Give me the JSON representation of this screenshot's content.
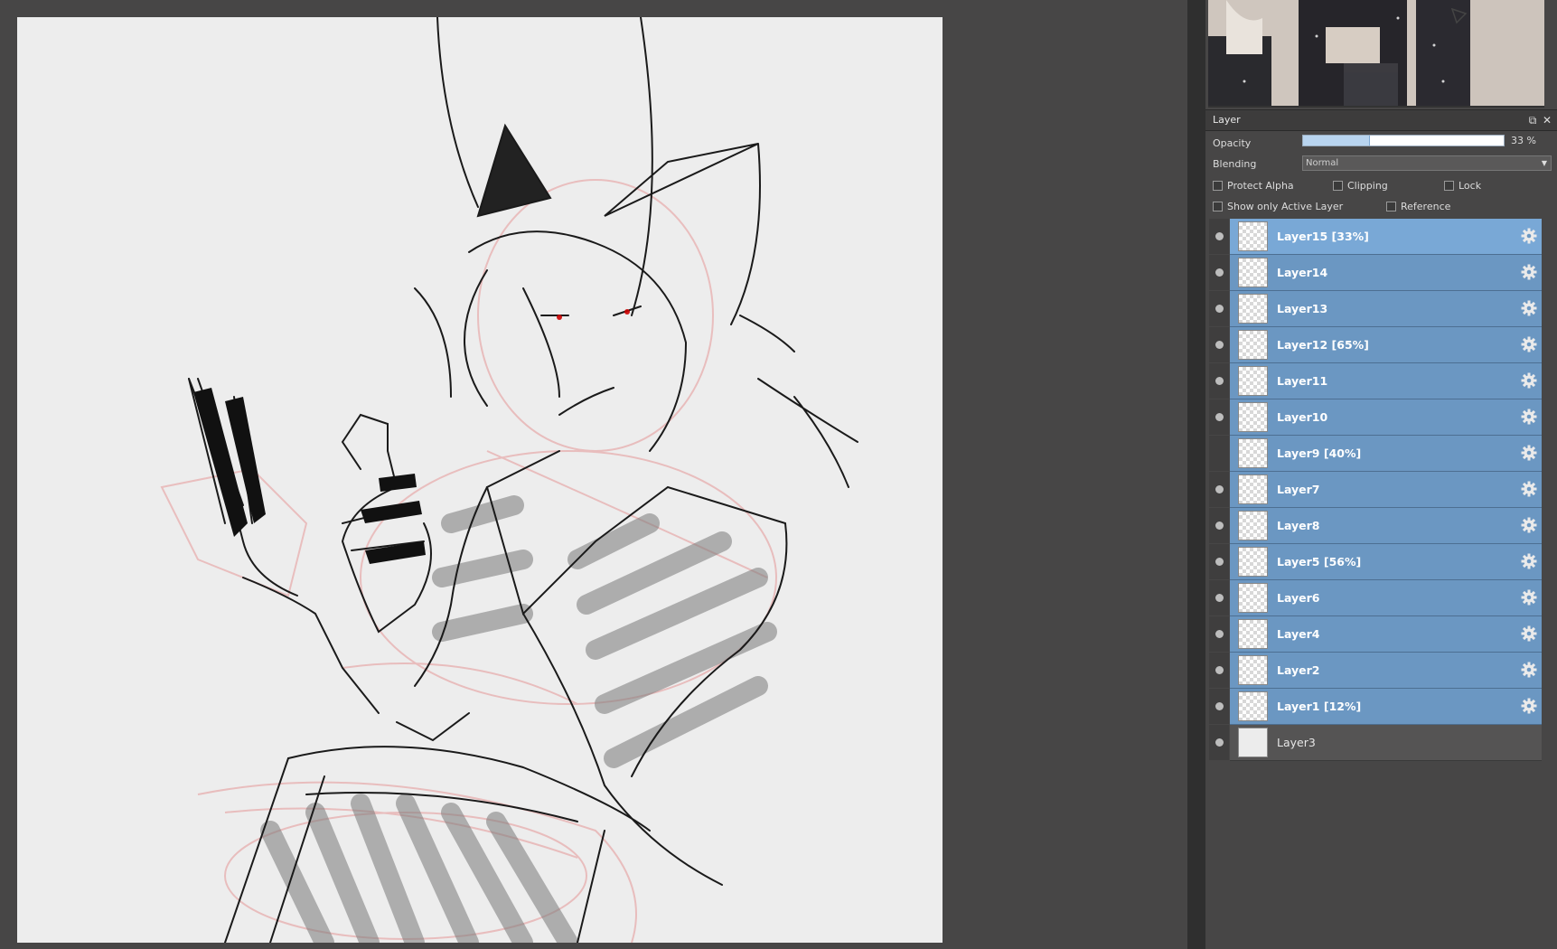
{
  "layer_panel": {
    "title": "Layer",
    "opacity_label": "Opacity",
    "opacity_value": "33 %",
    "opacity_fraction": 0.33,
    "blending_label": "Blending",
    "blending_value": "Normal",
    "checkboxes": {
      "protect_alpha": "Protect Alpha",
      "clipping": "Clipping",
      "lock": "Lock",
      "show_only_active": "Show only Active Layer",
      "reference": "Reference"
    },
    "layers": [
      {
        "name": "Layer15 [33%]",
        "visible": true,
        "active": true
      },
      {
        "name": "Layer14",
        "visible": true
      },
      {
        "name": "Layer13",
        "visible": true
      },
      {
        "name": "Layer12 [65%]",
        "visible": true
      },
      {
        "name": "Layer11",
        "visible": true
      },
      {
        "name": "Layer10",
        "visible": true
      },
      {
        "name": "Layer9 [40%]",
        "visible": false
      },
      {
        "name": "Layer7",
        "visible": true
      },
      {
        "name": "Layer8",
        "visible": true
      },
      {
        "name": "Layer5 [56%]",
        "visible": true
      },
      {
        "name": "Layer6",
        "visible": true
      },
      {
        "name": "Layer4",
        "visible": true
      },
      {
        "name": "Layer2",
        "visible": true
      },
      {
        "name": "Layer1 [12%]",
        "visible": true
      },
      {
        "name": "Layer3",
        "visible": true,
        "plain": true
      }
    ]
  },
  "icons": {
    "visibility": "eye-dot-icon",
    "settings": "gear-icon",
    "float": "float-window-icon",
    "close": "close-icon"
  },
  "colors": {
    "selected_layer": "#79a8d6",
    "layer_row": "#6b97c2",
    "background": "#474646",
    "canvas": "#ededed"
  }
}
